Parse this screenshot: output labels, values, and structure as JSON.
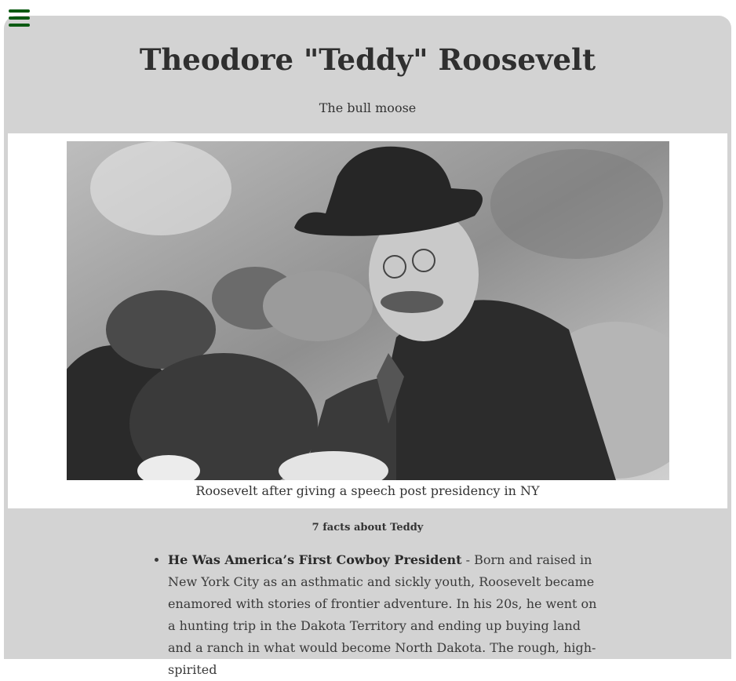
{
  "menu": {
    "icon": "hamburger-menu-icon",
    "color": "#0b5a12"
  },
  "page": {
    "title": "Theodore \"Teddy\" Roosevelt",
    "subtitle": "The bull moose"
  },
  "figure": {
    "image_alt": "Roosevelt after giving a speech post presidency in NY",
    "caption": "Roosevelt after giving a speech post presidency in NY"
  },
  "facts": {
    "heading": "7 facts about Teddy",
    "items": [
      {
        "title": "He Was America’s First Cowboy President",
        "text": " - Born and raised in New York City as an asthmatic and sickly youth, Roosevelt became enamored with stories of frontier adventure. In his 20s, he went on a hunting trip in the Dakota Territory and ending up buying land and a ranch in what would become North Dakota. The rough, high-spirited"
      }
    ]
  },
  "colors": {
    "background": "#d3d3d3",
    "figure_background": "#ffffff",
    "menu_icon": "#0b5a12"
  }
}
